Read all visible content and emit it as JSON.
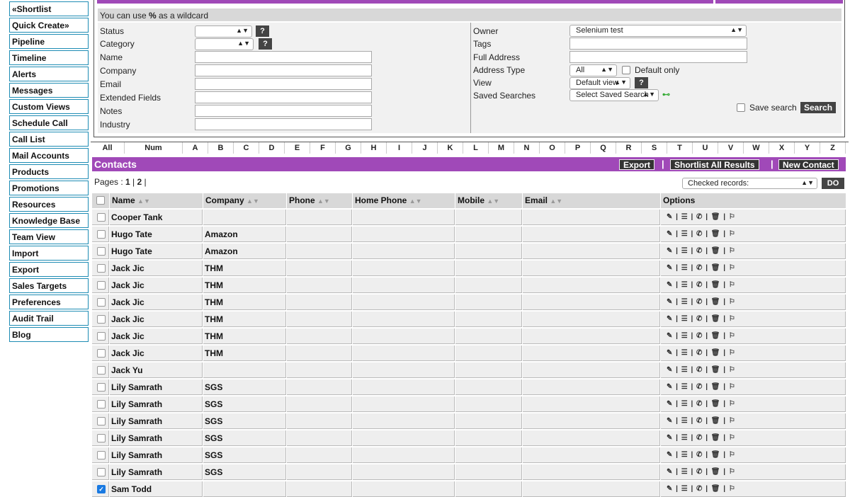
{
  "sidebar": {
    "items": [
      {
        "label": "«Shortlist"
      },
      {
        "label": "Quick Create»"
      },
      {
        "label": "Pipeline"
      },
      {
        "label": "Timeline"
      },
      {
        "label": "Alerts"
      },
      {
        "label": "Messages"
      },
      {
        "label": "Custom Views"
      },
      {
        "label": "Schedule Call"
      },
      {
        "label": "Call List"
      },
      {
        "label": "Mail Accounts"
      },
      {
        "label": "Products"
      },
      {
        "label": "Promotions"
      },
      {
        "label": "Resources"
      },
      {
        "label": "Knowledge Base"
      },
      {
        "label": "Team View"
      },
      {
        "label": "Import"
      },
      {
        "label": "Export"
      },
      {
        "label": "Sales Targets"
      },
      {
        "label": "Preferences"
      },
      {
        "label": "Audit Trail"
      },
      {
        "label": "Blog"
      }
    ]
  },
  "search": {
    "wildcard_pre": "You can use ",
    "wildcard_sym": "%",
    "wildcard_post": " as a wildcard",
    "status_label": "Status",
    "category_label": "Category",
    "name_label": "Name",
    "company_label": "Company",
    "email_label": "Email",
    "extended_label": "Extended Fields",
    "notes_label": "Notes",
    "industry_label": "Industry",
    "owner_label": "Owner",
    "owner_value": "Selenium test",
    "tags_label": "Tags",
    "full_address_label": "Full Address",
    "address_type_label": "Address Type",
    "address_type_value": "All",
    "default_only_label": "Default only",
    "view_label": "View",
    "view_value": "Default view",
    "saved_searches_label": "Saved Searches",
    "saved_search_value": "Select Saved Search",
    "save_search_label": "Save search",
    "search_button": "Search",
    "help": "?"
  },
  "alpha": [
    "All",
    "Num",
    "A",
    "B",
    "C",
    "D",
    "E",
    "F",
    "G",
    "H",
    "I",
    "J",
    "K",
    "L",
    "M",
    "N",
    "O",
    "P",
    "Q",
    "R",
    "S",
    "T",
    "U",
    "V",
    "W",
    "X",
    "Y",
    "Z"
  ],
  "contacts": {
    "title": "Contacts",
    "export_label": "Export",
    "shortlist_label": "Shortlist All Results",
    "new_label": "New Contact",
    "sep": "|",
    "pages_label": "Pages : ",
    "page1": "1",
    "page2": "2",
    "page_sep": " | ",
    "page_end": " |",
    "checked_records": "Checked records:",
    "do_label": "DO",
    "sort_glyph": "▲▼",
    "columns": {
      "name": "Name",
      "company": "Company",
      "phone": "Phone",
      "home_phone": "Home Phone",
      "mobile": "Mobile",
      "email": "Email",
      "options": "Options"
    },
    "options_glyphs": "✎ | ☰ | ✆ | 🗑 | ⚐",
    "rows": [
      {
        "name": "Cooper Tank",
        "company": "",
        "checked": false
      },
      {
        "name": "Hugo Tate",
        "company": "Amazon",
        "checked": false
      },
      {
        "name": "Hugo Tate",
        "company": "Amazon",
        "checked": false
      },
      {
        "name": "Jack Jic",
        "company": "THM",
        "checked": false
      },
      {
        "name": "Jack Jic",
        "company": "THM",
        "checked": false
      },
      {
        "name": "Jack Jic",
        "company": "THM",
        "checked": false
      },
      {
        "name": "Jack Jic",
        "company": "THM",
        "checked": false
      },
      {
        "name": "Jack Jic",
        "company": "THM",
        "checked": false
      },
      {
        "name": "Jack Jic",
        "company": "THM",
        "checked": false
      },
      {
        "name": "Jack Yu",
        "company": "",
        "checked": false
      },
      {
        "name": "Lily Samrath",
        "company": "SGS",
        "checked": false
      },
      {
        "name": "Lily Samrath",
        "company": "SGS",
        "checked": false
      },
      {
        "name": "Lily Samrath",
        "company": "SGS",
        "checked": false
      },
      {
        "name": "Lily Samrath",
        "company": "SGS",
        "checked": false
      },
      {
        "name": "Lily Samrath",
        "company": "SGS",
        "checked": false
      },
      {
        "name": "Lily Samrath",
        "company": "SGS",
        "checked": false
      },
      {
        "name": "Sam Todd",
        "company": "",
        "checked": true
      }
    ]
  },
  "colors": {
    "accent": "#a049b8",
    "sidebar_border": "#1e8cb4",
    "button": "#444444"
  }
}
